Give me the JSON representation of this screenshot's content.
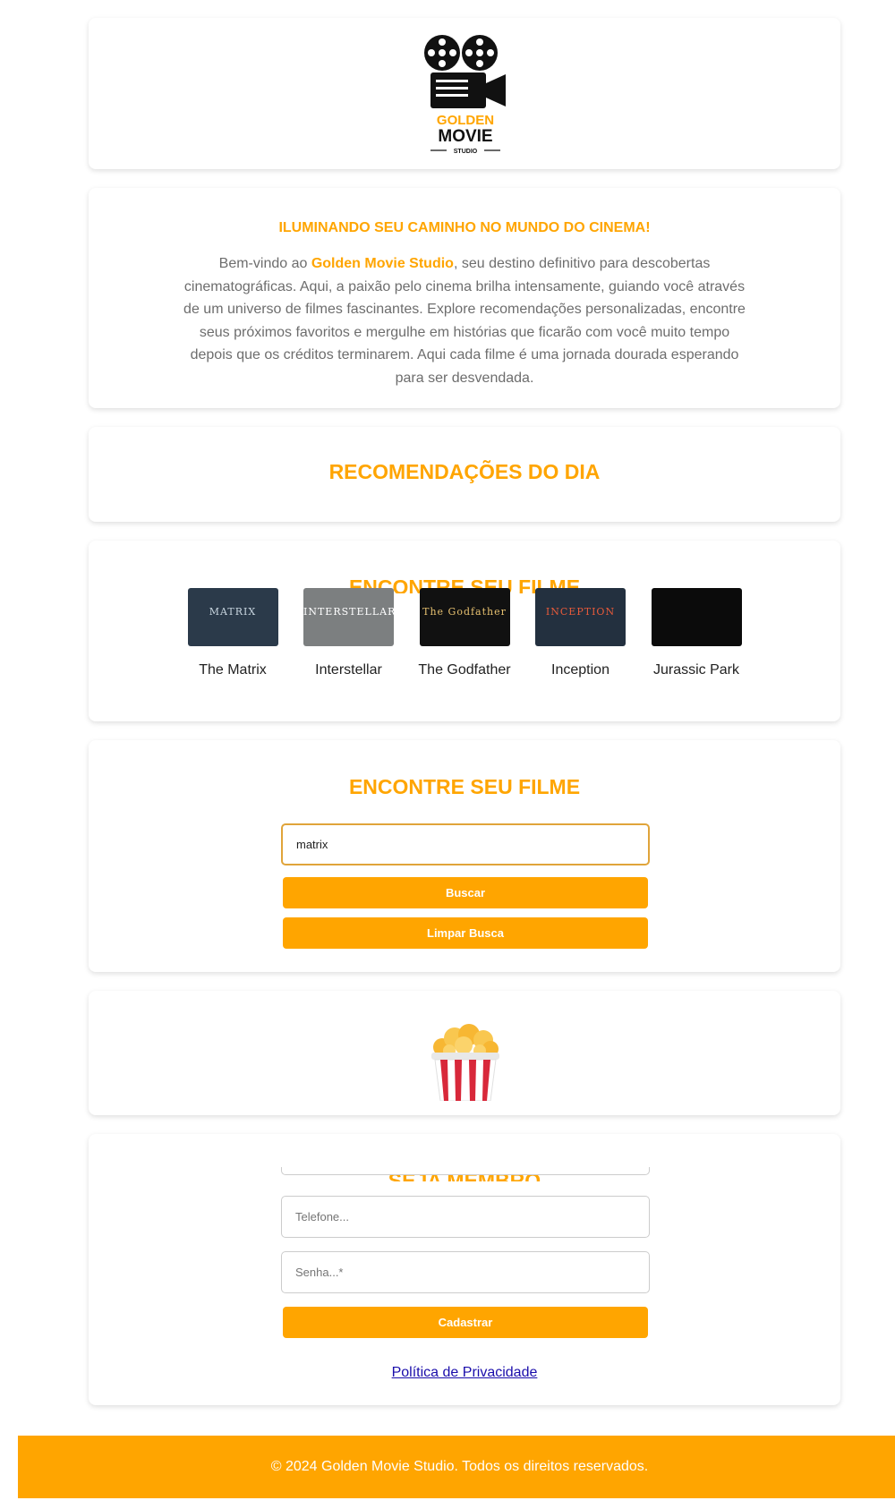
{
  "header": {
    "logo_line1": "GOLDEN",
    "logo_line2": "MOVIE",
    "logo_line3": "STUDIO"
  },
  "intro": {
    "title": "ILUMINANDO SEU CAMINHO NO MUNDO DO CINEMA!",
    "text_before": "Bem-vindo ao ",
    "brand": "Golden Movie Studio",
    "text_after": ", seu destino definitivo para descobertas cinematográficas. Aqui, a paixão pelo cinema brilha intensamente, guiando você através de um universo de filmes fascinantes. Explore recomendações personalizadas, encontre seus próximos favoritos e mergulhe em histórias que ficarão com você muito tempo depois que os créditos terminarem. Aqui cada filme é uma jornada dourada esperando para ser desvendada."
  },
  "recommendations": {
    "title": "RECOMENDAÇÕES DO DIA"
  },
  "films": {
    "ghost_title": "ENCONTRE SEU FILME",
    "items": [
      {
        "title": "The Matrix",
        "poster_text": "MATRIX",
        "poster_color": "#2b3a4a",
        "poster_text_color": "#c9d6e0"
      },
      {
        "title": "Interstellar",
        "poster_text": "INTERSTELLAR",
        "poster_color": "#7c7f80",
        "poster_text_color": "#ffffff"
      },
      {
        "title": "The Godfather",
        "poster_text": "The Godfather",
        "poster_color": "#111111",
        "poster_text_color": "#e7c170"
      },
      {
        "title": "Inception",
        "poster_text": "INCEPTION",
        "poster_color": "#23303f",
        "poster_text_color": "#e85a3a"
      },
      {
        "title": "Jurassic Park",
        "poster_text": "",
        "poster_color": "#0b0b0b",
        "poster_text_color": "#aaaaaa"
      }
    ]
  },
  "search": {
    "title": "ENCONTRE SEU FILME",
    "value": "matrix",
    "search_button": "Buscar",
    "clear_button": "Limpar Busca"
  },
  "member": {
    "ghost_title": "SEJA MEMBRO",
    "phone_placeholder": "Telefone...",
    "password_placeholder": "Senha...*",
    "submit": "Cadastrar",
    "privacy": "Política de Privacidade"
  },
  "footer": {
    "text": "© 2024 Golden Movie Studio. Todos os direitos reservados."
  },
  "colors": {
    "accent": "#FFA500",
    "link": "#1a0dab",
    "popcorn_stripe": "#d8283a"
  }
}
